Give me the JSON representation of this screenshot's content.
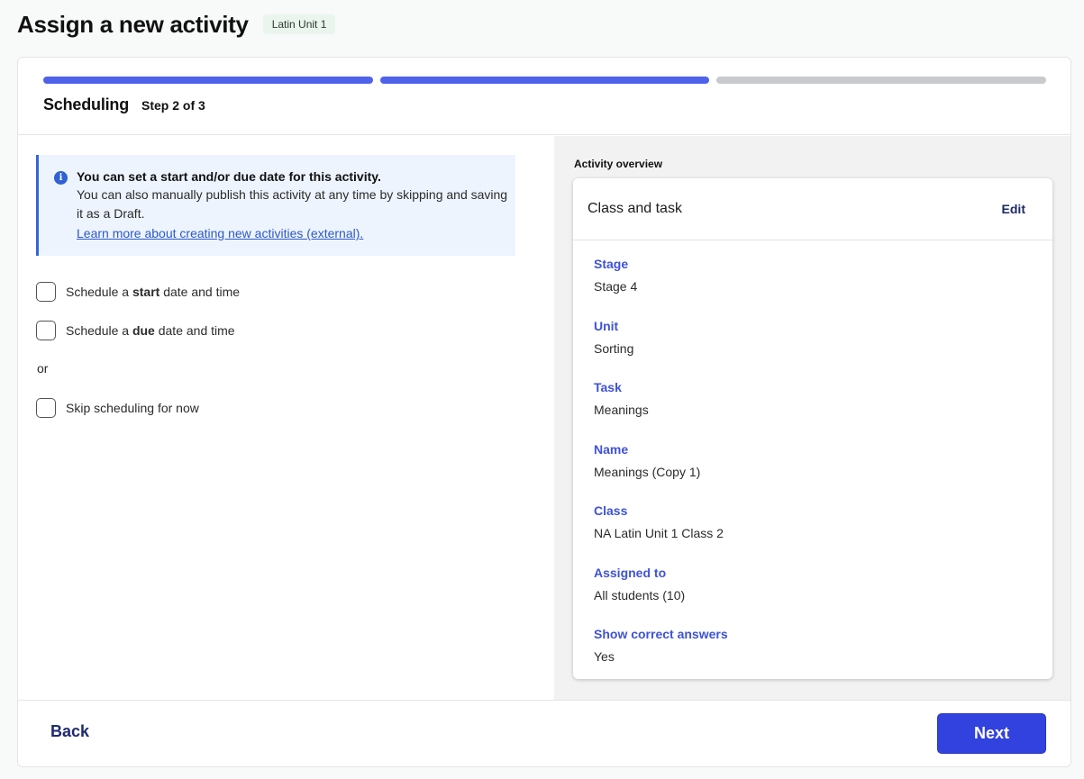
{
  "header": {
    "title": "Assign a new activity",
    "badge": "Latin Unit 1"
  },
  "progress": {
    "current_step": 2,
    "total_steps": 3,
    "step_title": "Scheduling",
    "step_label": "Step 2 of 3"
  },
  "info": {
    "heading": "You can set a start and/or due date for this activity.",
    "body": "You can also manually publish this activity at any time by skipping and saving it as a Draft.",
    "link": "Learn more about creating new activities (external)."
  },
  "options": {
    "start_prefix": "Schedule a ",
    "start_bold": "start",
    "start_suffix": " date and time",
    "due_prefix": "Schedule a ",
    "due_bold": "due",
    "due_suffix": " date and time",
    "or": "or",
    "skip": "Skip scheduling for now"
  },
  "overview": {
    "section_label": "Activity overview",
    "card_title": "Class and task",
    "edit_label": "Edit",
    "fields": [
      {
        "label": "Stage",
        "value": "Stage 4"
      },
      {
        "label": "Unit",
        "value": "Sorting"
      },
      {
        "label": "Task",
        "value": "Meanings"
      },
      {
        "label": "Name",
        "value": "Meanings (Copy 1)"
      },
      {
        "label": "Class",
        "value": "NA Latin Unit 1 Class 2"
      },
      {
        "label": "Assigned to",
        "value": "All students (10)"
      },
      {
        "label": "Show correct answers",
        "value": "Yes"
      }
    ]
  },
  "footer": {
    "back_label": "Back",
    "next_label": "Next"
  },
  "colors": {
    "primary": "#3242de",
    "progress_done": "#4f62ea",
    "progress_todo": "#c8cacd",
    "field_label": "#3e53d6",
    "info_bg": "#edf4fe"
  }
}
